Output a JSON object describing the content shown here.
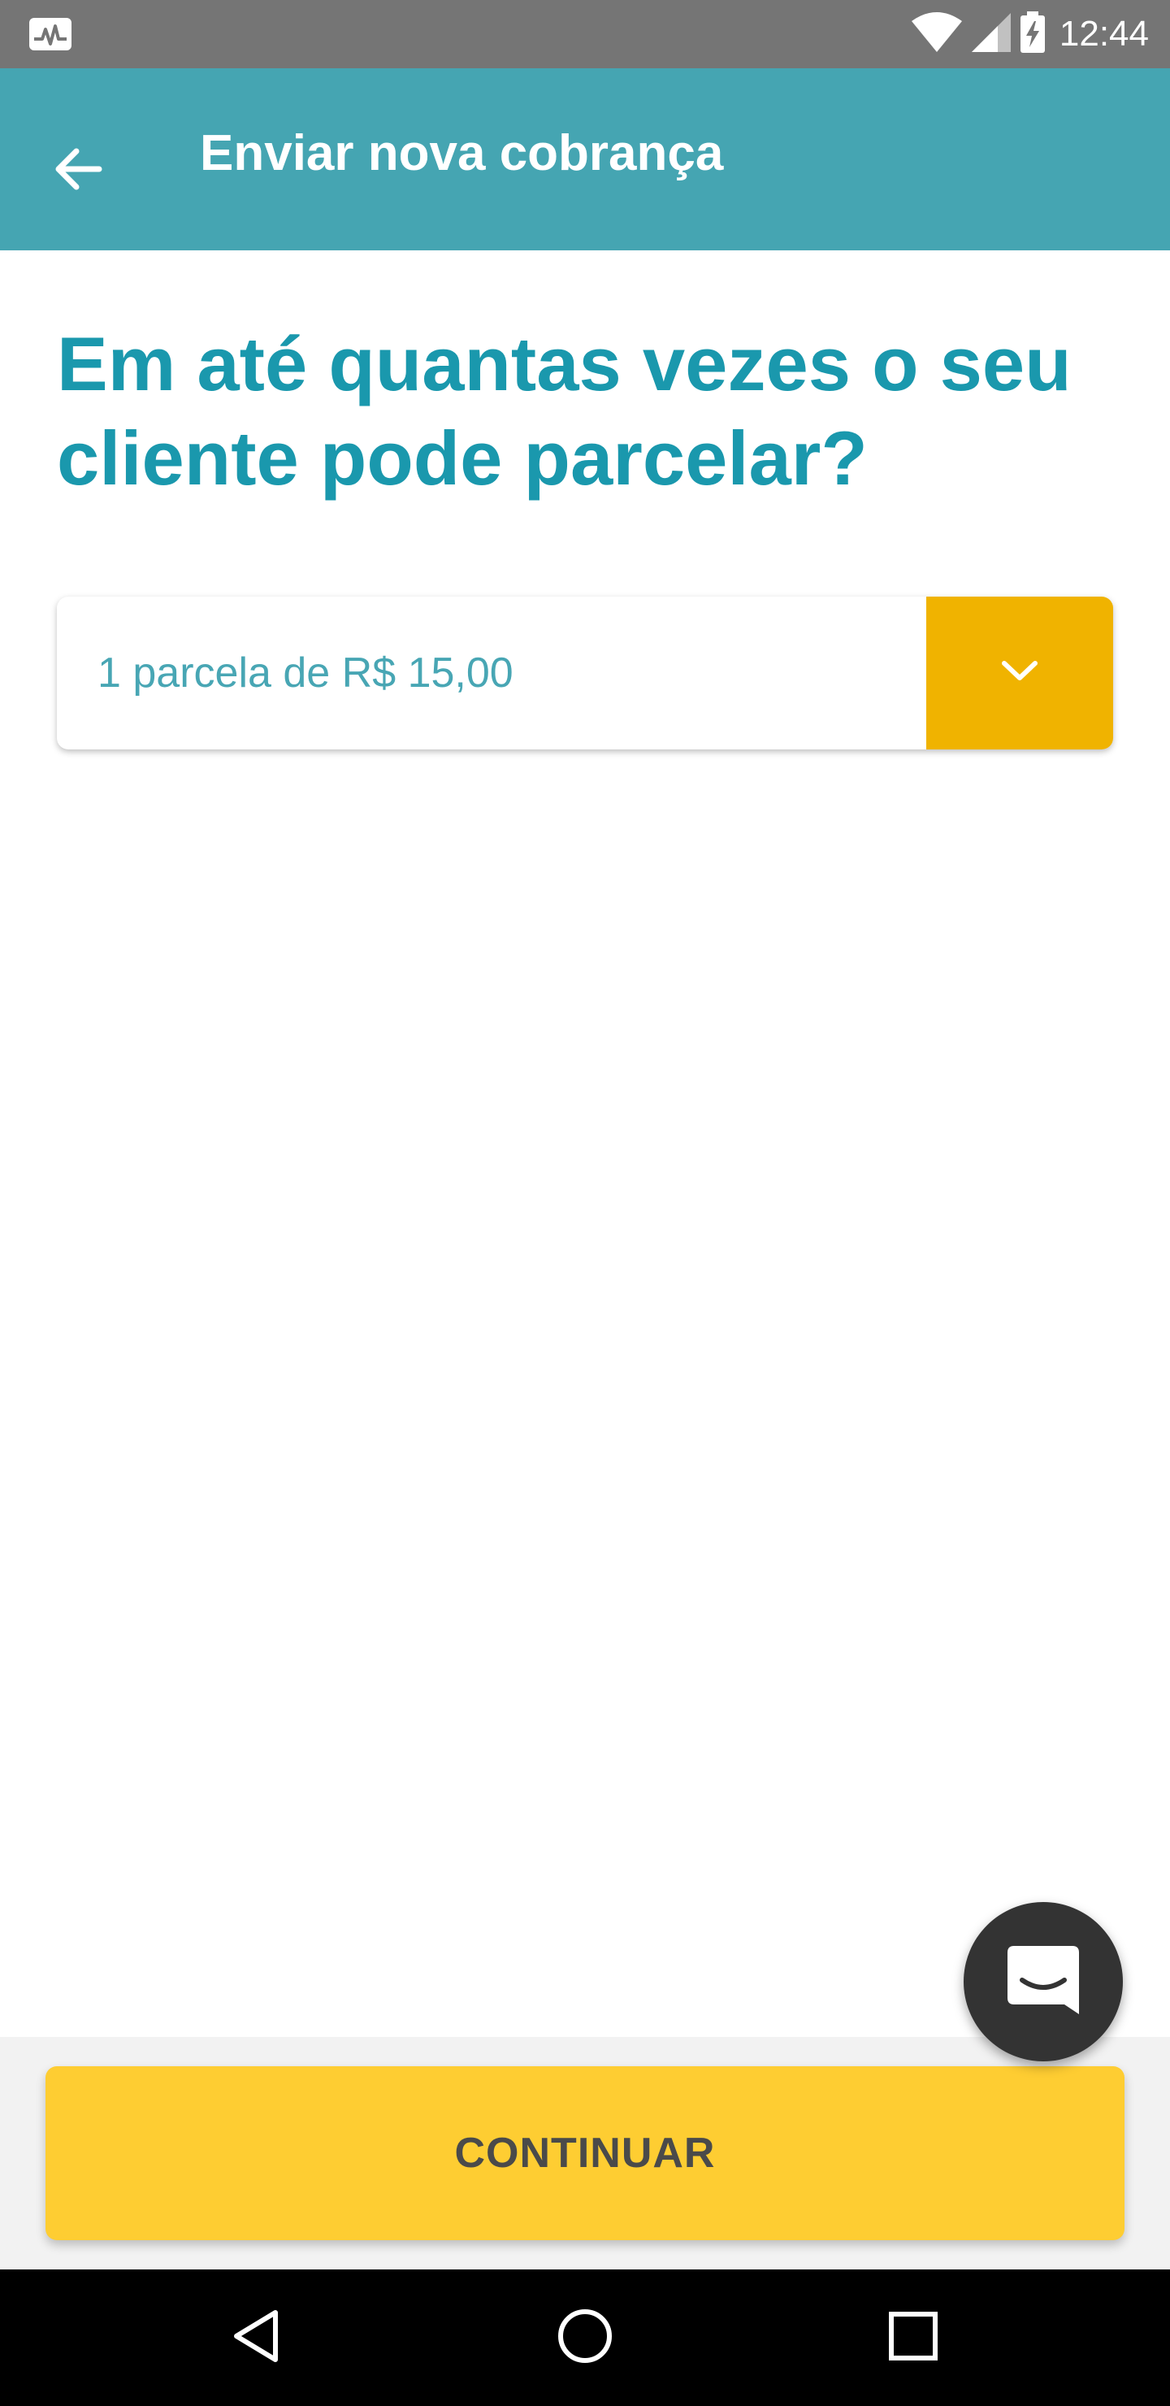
{
  "status_bar": {
    "time": "12:44",
    "icons": [
      "activity-app-icon",
      "wifi-icon",
      "cell-signal-icon",
      "battery-charging-icon"
    ]
  },
  "app_bar": {
    "title": "Enviar nova cobrança",
    "back_icon": "arrow-back-icon"
  },
  "main": {
    "question": "Em até quantas vezes o seu cliente pode parcelar?",
    "installments_select": {
      "selected_value": "1 parcela de R$ 15,00",
      "toggle_icon": "chevron-down-icon"
    }
  },
  "chat_fab": {
    "icon": "chat-bubble-icon"
  },
  "footer": {
    "continue_label": "CONTINUAR"
  },
  "nav_bar": {
    "icons": [
      "back-triangle-icon",
      "home-circle-icon",
      "recents-square-icon"
    ]
  },
  "colors": {
    "status_bar": "#757575",
    "app_bar": "#45a5b2",
    "question_text": "#1a98ad",
    "select_text": "#48a6b4",
    "select_toggle": "#f0b300",
    "continue_button": "#fecd32",
    "continue_text": "#4a4a4a",
    "chat_fab": "#333333"
  }
}
